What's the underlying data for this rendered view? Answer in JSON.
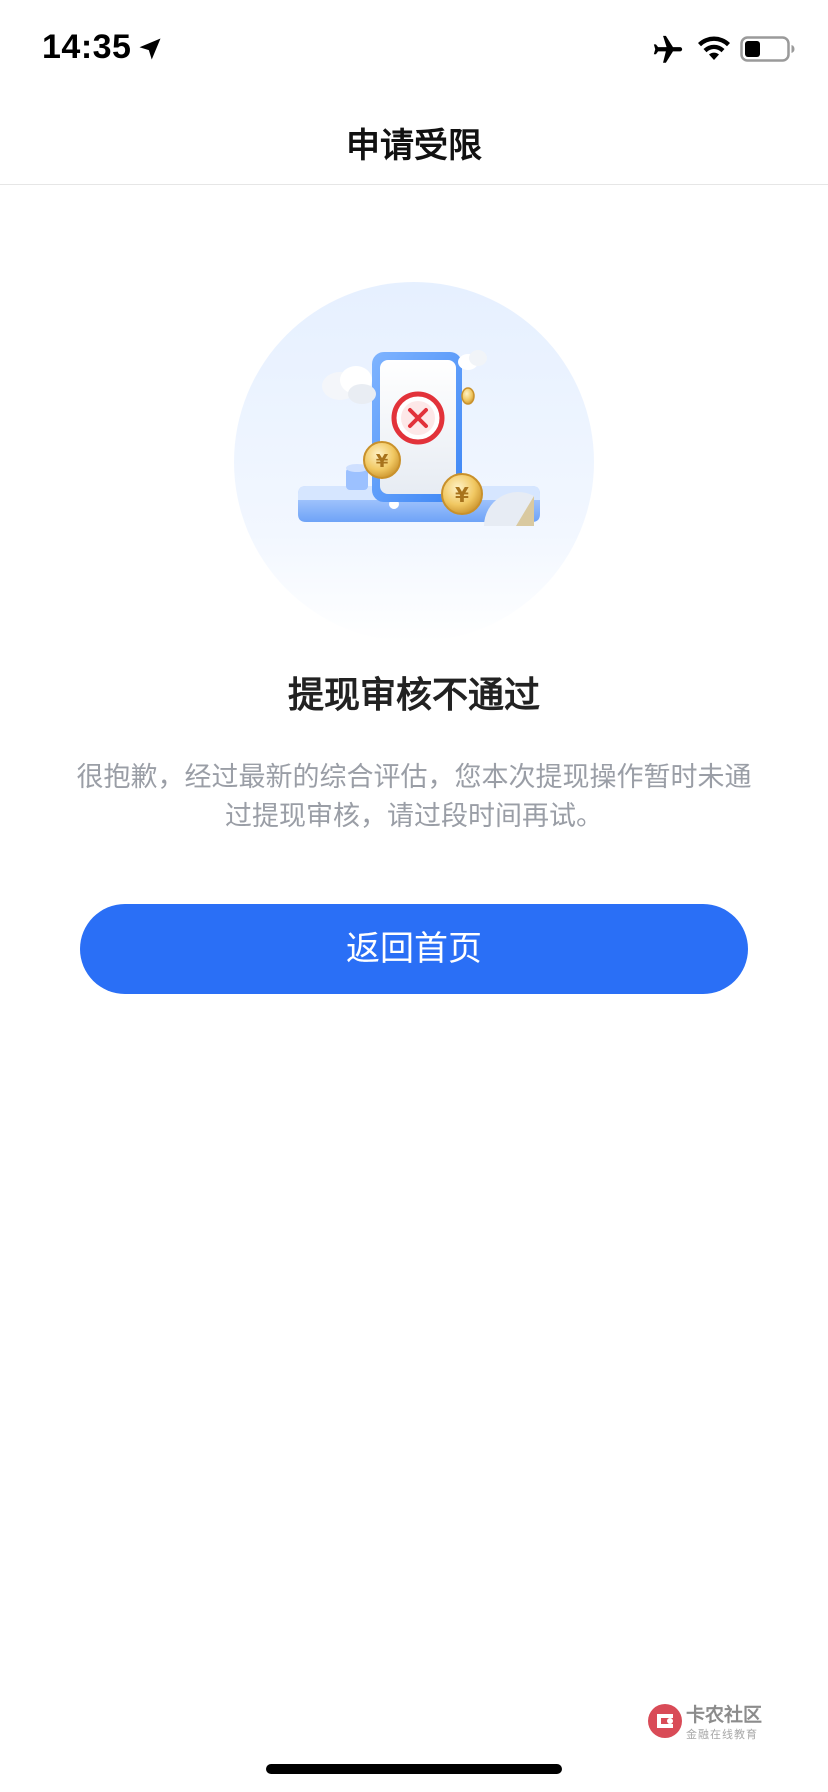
{
  "status_bar": {
    "time": "14:35",
    "icons": [
      "location-arrow-icon",
      "airplane-icon",
      "wifi-icon",
      "battery-icon"
    ]
  },
  "nav": {
    "title": "申请受限"
  },
  "illustration": {
    "icon": "withdrawal-rejected-illustration",
    "mark": "×",
    "coin_symbol": "¥"
  },
  "result": {
    "title": "提现审核不通过",
    "description": "很抱歉，经过最新的综合评估，您本次提现操作暂时未通过提现审核，请过段时间再试。"
  },
  "actions": {
    "home_button_label": "返回首页"
  },
  "watermark": {
    "name": "卡农社区",
    "subtitle": "金融在线教育"
  },
  "colors": {
    "accent": "#2a6ff6",
    "error": "#e2323a",
    "coin": "#e8b84a",
    "description_text": "#9a9ea6"
  }
}
